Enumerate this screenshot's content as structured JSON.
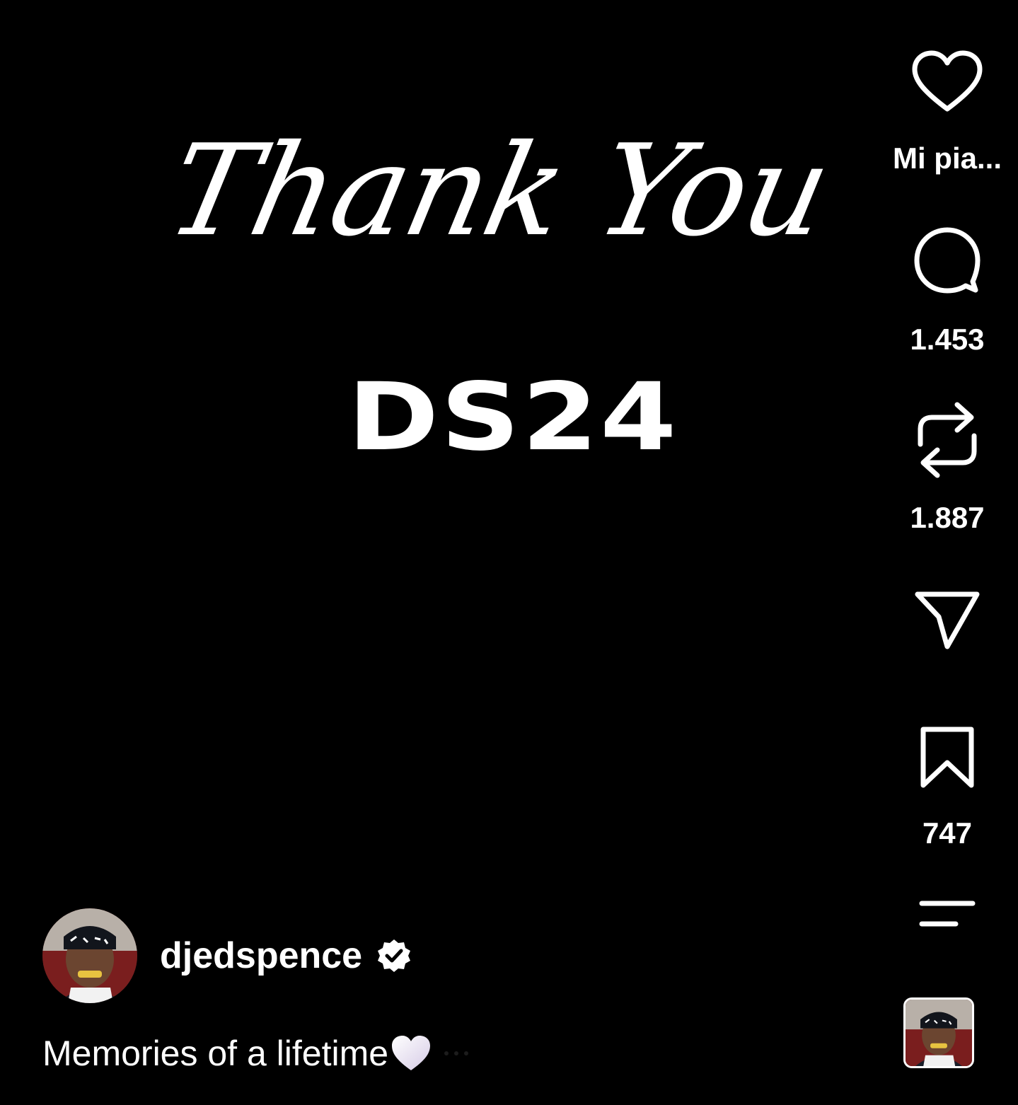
{
  "post": {
    "script_line": "Thank You",
    "brand_line": "DS24"
  },
  "actions": {
    "like_label": "Mi pia...",
    "comment_count": "1.453",
    "repost_count": "1.887",
    "save_count": "747"
  },
  "author": {
    "username": "djedspence",
    "verified": true
  },
  "caption": {
    "text": "Memories of a lifetime"
  },
  "icons": {
    "like": "heart-outline-icon",
    "comment": "comment-bubble-icon",
    "repost": "repost-arrows-icon",
    "share": "paper-plane-icon",
    "save": "bookmark-icon",
    "menu": "menu-lines-icon",
    "verified": "verified-badge-icon",
    "caption_emoji": "white-heart-emoji"
  },
  "colors": {
    "background": "#000000",
    "foreground": "#ffffff"
  }
}
